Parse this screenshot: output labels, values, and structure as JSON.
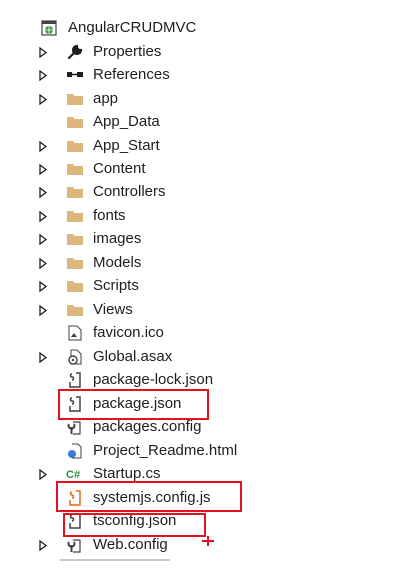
{
  "solution_explorer": {
    "project": {
      "label": "AngularCRUDMVC",
      "icon": "web-project-icon"
    },
    "items": [
      {
        "label": "Properties",
        "icon": "wrench-icon",
        "expandable": true
      },
      {
        "label": "References",
        "icon": "references-icon",
        "expandable": true
      },
      {
        "label": "app",
        "icon": "folder-icon",
        "expandable": true
      },
      {
        "label": "App_Data",
        "icon": "folder-icon",
        "expandable": false
      },
      {
        "label": "App_Start",
        "icon": "folder-icon",
        "expandable": true
      },
      {
        "label": "Content",
        "icon": "folder-icon",
        "expandable": true
      },
      {
        "label": "Controllers",
        "icon": "folder-icon",
        "expandable": true
      },
      {
        "label": "fonts",
        "icon": "folder-icon",
        "expandable": true
      },
      {
        "label": "images",
        "icon": "folder-icon",
        "expandable": true
      },
      {
        "label": "Models",
        "icon": "folder-icon",
        "expandable": true
      },
      {
        "label": "Scripts",
        "icon": "folder-icon",
        "expandable": true
      },
      {
        "label": "Views",
        "icon": "folder-icon",
        "expandable": true
      },
      {
        "label": "favicon.ico",
        "icon": "ico-file-icon",
        "expandable": false
      },
      {
        "label": "Global.asax",
        "icon": "asax-file-icon",
        "expandable": true
      },
      {
        "label": "package-lock.json",
        "icon": "json-file-icon",
        "expandable": false
      },
      {
        "label": "package.json",
        "icon": "json-file-icon",
        "expandable": false,
        "highlighted": true
      },
      {
        "label": "packages.config",
        "icon": "config-file-icon",
        "expandable": false
      },
      {
        "label": "Project_Readme.html",
        "icon": "html-file-icon",
        "expandable": false
      },
      {
        "label": "Startup.cs",
        "icon": "csharp-file-icon",
        "expandable": true
      },
      {
        "label": "systemjs.config.js",
        "icon": "js-file-icon",
        "expandable": false,
        "highlighted": true
      },
      {
        "label": "tsconfig.json",
        "icon": "json-file-icon",
        "expandable": false,
        "highlighted": true
      },
      {
        "label": "Web.config",
        "icon": "config-file-icon",
        "expandable": true
      }
    ]
  },
  "colors": {
    "highlight": "#e0141e",
    "folder": "#dcb67a",
    "text": "#1e1e1e",
    "arrow": "#1e1e1e"
  }
}
